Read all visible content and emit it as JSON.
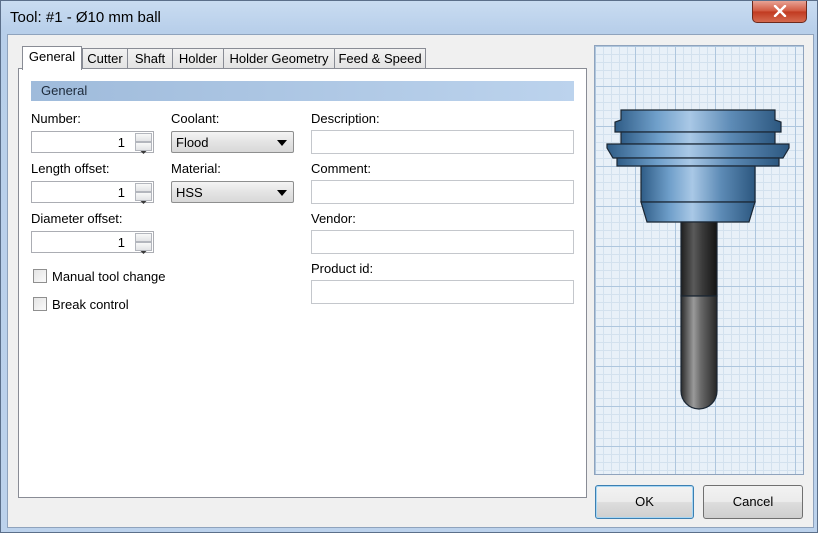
{
  "window": {
    "title": "Tool: #1 - Ø10 mm ball"
  },
  "tabs": [
    {
      "label": "General",
      "active": true
    },
    {
      "label": "Cutter",
      "active": false
    },
    {
      "label": "Shaft",
      "active": false
    },
    {
      "label": "Holder",
      "active": false
    },
    {
      "label": "Holder Geometry",
      "active": false
    },
    {
      "label": "Feed & Speed",
      "active": false
    }
  ],
  "general": {
    "section_title": "General",
    "number": {
      "label": "Number:",
      "value": "1"
    },
    "length_offset": {
      "label": "Length offset:",
      "value": "1"
    },
    "diameter_offset": {
      "label": "Diameter offset:",
      "value": "1"
    },
    "coolant": {
      "label": "Coolant:",
      "value": "Flood"
    },
    "material": {
      "label": "Material:",
      "value": "HSS"
    },
    "description": {
      "label": "Description:",
      "value": ""
    },
    "comment": {
      "label": "Comment:",
      "value": ""
    },
    "vendor": {
      "label": "Vendor:",
      "value": ""
    },
    "product_id": {
      "label": "Product id:",
      "value": ""
    },
    "manual_tool_change": {
      "label": "Manual tool change",
      "checked": false
    },
    "break_control": {
      "label": "Break control",
      "checked": false
    }
  },
  "buttons": {
    "ok": "OK",
    "cancel": "Cancel"
  },
  "colors": {
    "holder": "#4f7ea8",
    "shank": "#3d3d3d",
    "tab_panel_header": "#b0c9e6"
  }
}
